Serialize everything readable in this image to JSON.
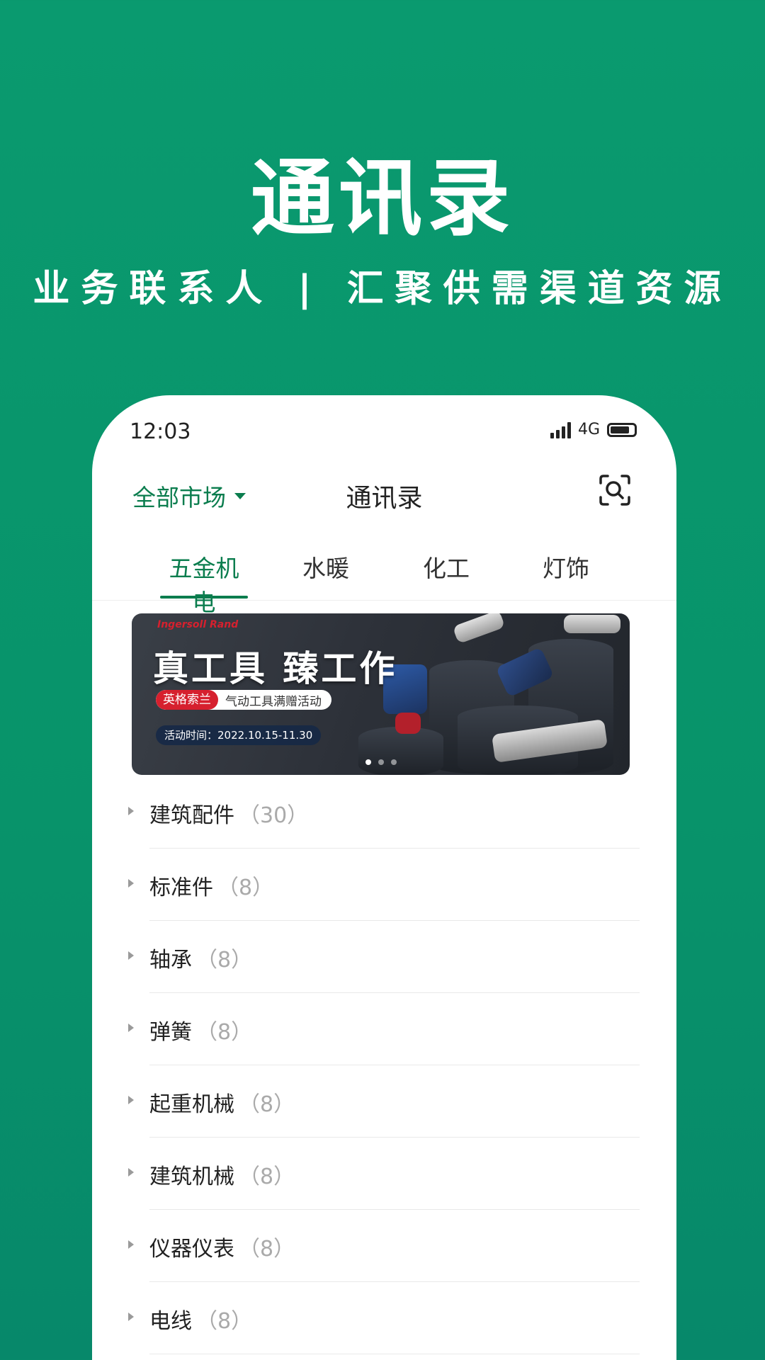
{
  "hero": {
    "title": "通讯录",
    "subtitle": "业务联系人 | 汇聚供需渠道资源"
  },
  "status_bar": {
    "time": "12:03",
    "network": "4G"
  },
  "nav": {
    "market_label": "全部市场",
    "title": "通讯录"
  },
  "tabs": [
    {
      "label": "五金机电",
      "active": true
    },
    {
      "label": "水暖",
      "active": false
    },
    {
      "label": "化工",
      "active": false
    },
    {
      "label": "灯饰",
      "active": false
    }
  ],
  "banner": {
    "brand": "Ingersoll Rand",
    "headline": "真工具 臻工作",
    "pill_brand": "英格索兰",
    "pill_text": "气动工具满赠活动",
    "date": "活动时间：2022.10.15-11.30",
    "active_dot": 0,
    "dot_count": 3
  },
  "categories": [
    {
      "name": "建筑配件",
      "count": "（30）"
    },
    {
      "name": "标准件",
      "count": "（8）"
    },
    {
      "name": "轴承",
      "count": "（8）"
    },
    {
      "name": "弹簧",
      "count": "（8）"
    },
    {
      "name": "起重机械",
      "count": "（8）"
    },
    {
      "name": "建筑机械",
      "count": "（8）"
    },
    {
      "name": "仪器仪表",
      "count": "（8）"
    },
    {
      "name": "电线",
      "count": "（8）"
    }
  ],
  "colors": {
    "brand_green": "#0b7d4e",
    "background_green": "#08936a",
    "promo_red": "#d6202e"
  },
  "icons": {
    "scan": "scan-search-icon",
    "dropdown": "caret-down-icon",
    "expand": "triangle-right-icon"
  }
}
